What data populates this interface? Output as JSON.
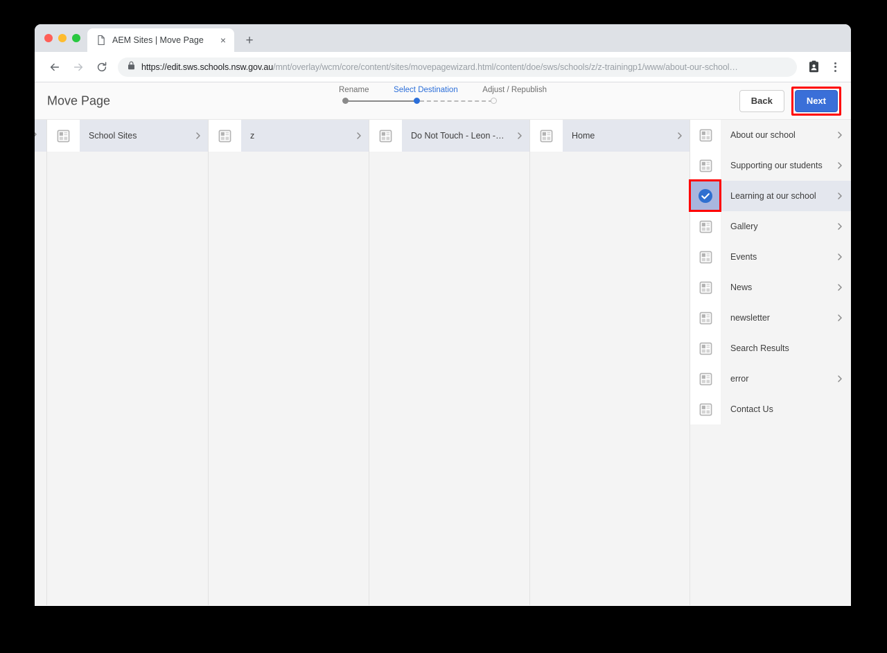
{
  "browser": {
    "tab": {
      "title": "AEM Sites | Move Page",
      "favicon": "document-icon",
      "close": "×"
    },
    "new_tab": "+",
    "nav": {
      "back": "←",
      "forward": "→",
      "reload": "⟳"
    },
    "url": {
      "host": "https://edit.sws.schools.nsw.gov.au",
      "path": "/mnt/overlay/wcm/core/content/sites/movepagewizard.html/content/doe/sws/schools/z/z-trainingp1/www/about-our-school…"
    },
    "profile_icon": "profile-card-icon",
    "menu_icon": "kebab-menu-icon"
  },
  "app": {
    "title": "Move Page",
    "stepper": {
      "steps": [
        {
          "label": "Rename",
          "state": "done"
        },
        {
          "label": "Select Destination",
          "state": "active"
        },
        {
          "label": "Adjust / Republish",
          "state": "pending"
        }
      ]
    },
    "actions": {
      "back_label": "Back",
      "next_label": "Next",
      "next_highlighted": true
    }
  },
  "columns": [
    {
      "label": "School Sites",
      "icon": "page-icon",
      "chevron": true
    },
    {
      "label": "z",
      "icon": "page-icon",
      "chevron": true
    },
    {
      "label": "Do Not Touch - Leon - ...",
      "icon": "page-icon",
      "chevron": true
    },
    {
      "label": "Home",
      "icon": "page-icon",
      "chevron": true
    }
  ],
  "list": {
    "items": [
      {
        "label": "About our school",
        "icon": "page-icon",
        "chevron": true,
        "selected": false
      },
      {
        "label": "Supporting our students",
        "icon": "page-icon",
        "chevron": true,
        "selected": false
      },
      {
        "label": "Learning at our school",
        "icon": "check-icon",
        "chevron": true,
        "selected": true,
        "highlighted": true
      },
      {
        "label": "Gallery",
        "icon": "page-icon",
        "chevron": true,
        "selected": false
      },
      {
        "label": "Events",
        "icon": "page-icon",
        "chevron": true,
        "selected": false
      },
      {
        "label": "News",
        "icon": "page-icon",
        "chevron": true,
        "selected": false
      },
      {
        "label": "newsletter",
        "icon": "page-icon",
        "chevron": true,
        "selected": false
      },
      {
        "label": "Search Results",
        "icon": "page-icon",
        "chevron": false,
        "selected": false
      },
      {
        "label": "error",
        "icon": "page-icon",
        "chevron": true,
        "selected": false
      },
      {
        "label": "Contact Us",
        "icon": "page-icon",
        "chevron": false,
        "selected": false
      }
    ]
  },
  "colors": {
    "accent_blue": "#3a6fd8",
    "link_blue": "#2b6ed9",
    "highlight_red": "#ff0000",
    "header_bg": "#e4e7ee",
    "panel_bg": "#f4f4f4"
  }
}
